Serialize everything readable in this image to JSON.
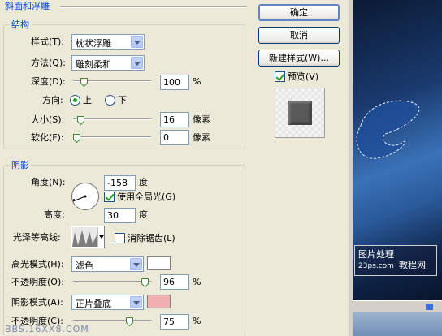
{
  "bevel_title": "斜面和浮雕",
  "structure": {
    "title": "结构",
    "style_label": "样式(T):",
    "style_value": "枕状浮雕",
    "technique_label": "方法(Q):",
    "technique_value": "雕刻柔和",
    "depth_label": "深度(D):",
    "depth_value": "100",
    "depth_unit": "%",
    "direction_label": "方向:",
    "direction_up": "上",
    "direction_down": "下",
    "size_label": "大小(S):",
    "size_value": "16",
    "size_unit": "像素",
    "soften_label": "软化(F):",
    "soften_value": "0",
    "soften_unit": "像素"
  },
  "shading": {
    "title": "阴影",
    "angle_label": "角度(N):",
    "angle_value": "-158",
    "angle_unit": "度",
    "global_light_label": "使用全局光(G)",
    "altitude_label": "高度:",
    "altitude_value": "30",
    "altitude_unit": "度",
    "gloss_label": "光泽等高线:",
    "antialias_label": "消除锯齿(L)",
    "highlight_mode_label": "高光模式(H):",
    "highlight_mode_value": "滤色",
    "highlight_opacity_label": "不透明度(O):",
    "highlight_opacity_value": "96",
    "highlight_opacity_unit": "%",
    "shadow_mode_label": "阴影模式(A):",
    "shadow_mode_value": "正片叠底",
    "shadow_opacity_label": "不透明度(C):",
    "shadow_opacity_value": "75",
    "shadow_opacity_unit": "%"
  },
  "buttons": {
    "ok": "确定",
    "cancel": "取消",
    "new_style": "新建样式(W)...",
    "preview": "预览(V)"
  },
  "canvas": {
    "watermark_line1": "图片处理",
    "watermark_line2": "23ps.com",
    "watermark_line3": "教程网"
  },
  "footer_watermark": "BBS.16XX8.COM",
  "colors": {
    "highlight": "#ffffff",
    "shadow": "#f2b0b0",
    "accent_blue": "#0046d5"
  },
  "levels": {
    "depth": 0.1,
    "size": 0.06,
    "soften": 0.0,
    "highlight_opacity": 0.96,
    "shadow_opacity": 0.75
  }
}
